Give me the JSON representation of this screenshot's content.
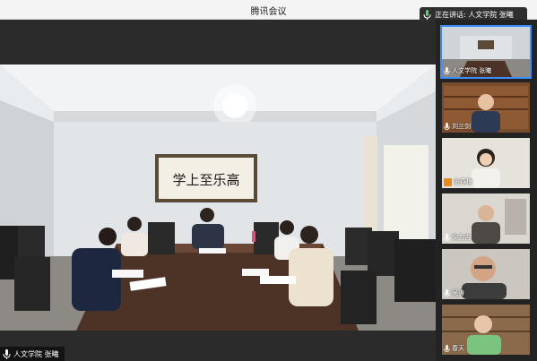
{
  "window": {
    "title": "腾讯会议"
  },
  "speaker_bar": {
    "label": "正在讲话: 人文学院 张曦"
  },
  "main_video": {
    "participant_name": "人文学院 张曦",
    "calligraphy": "学上至乐高"
  },
  "participants": [
    {
      "name": "人文学院 张曦",
      "mic": "mic-icon",
      "active": true
    },
    {
      "name": "刘兰剑",
      "mic": "mic-icon"
    },
    {
      "name": "张燕梅",
      "mic": "avatar-icon"
    },
    {
      "name": "安力吉",
      "mic": "mic-icon"
    },
    {
      "name": "吴涛",
      "mic": "mic-icon"
    },
    {
      "name": "春天",
      "mic": "mic-icon"
    }
  ],
  "colors": {
    "accent": "#3c8bff",
    "titlebar": "#f4f4f4",
    "sidebar": "#232323"
  }
}
